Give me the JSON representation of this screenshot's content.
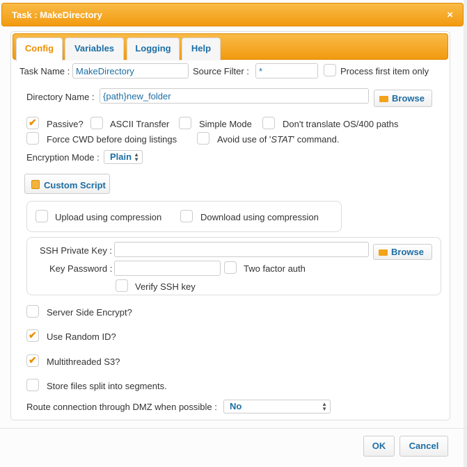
{
  "window": {
    "title": "Task : MakeDirectory",
    "close_glyph": "×"
  },
  "tabs": [
    {
      "label": "Config",
      "active": true
    },
    {
      "label": "Variables"
    },
    {
      "label": "Logging"
    },
    {
      "label": "Help"
    }
  ],
  "task_name": {
    "label": "Task Name :",
    "value": "MakeDirectory"
  },
  "source_filter": {
    "label": "Source Filter :",
    "value": "*"
  },
  "process_first": {
    "label": "Process first item only",
    "checked": false
  },
  "directory": {
    "label": "Directory Name :",
    "value": "{path}new_folder",
    "browse_label": "Browse"
  },
  "options": {
    "passive": {
      "label": "Passive?",
      "checked": true
    },
    "ascii": {
      "label": "ASCII Transfer",
      "checked": false
    },
    "simple": {
      "label": "Simple Mode",
      "checked": false
    },
    "os400": {
      "label": "Don't translate OS/400 paths",
      "checked": false
    },
    "force_cwd": {
      "label": "Force CWD before doing listings",
      "checked": false
    },
    "avoid_stat_prefix": "Avoid use of '",
    "avoid_stat_cmd": "STAT",
    "avoid_stat_suffix": "' command.",
    "avoid_stat_checked": false
  },
  "encryption": {
    "label": "Encryption Mode :",
    "value": "Plain"
  },
  "custom_script_label": "Custom Script",
  "compression": {
    "upload": {
      "label": "Upload using compression",
      "checked": false
    },
    "download": {
      "label": "Download using compression",
      "checked": false
    }
  },
  "ssh": {
    "private_key_label": "SSH Private Key :",
    "private_key_value": "",
    "browse_label": "Browse",
    "password_label": "Key Password :",
    "password_value": "",
    "two_factor": {
      "label": "Two factor auth",
      "checked": false
    },
    "verify": {
      "label": "Verify SSH key",
      "checked": false
    }
  },
  "s3": {
    "server_side_encrypt": {
      "label": "Server Side Encrypt?",
      "checked": false
    },
    "random_id": {
      "label": "Use Random ID?",
      "checked": true
    },
    "multithreaded": {
      "label": "Multithreaded S3?",
      "checked": true
    },
    "split_segments": {
      "label": "Store files split into segments.",
      "checked": false
    }
  },
  "dmz": {
    "label": "Route connection through DMZ when possible :",
    "value": "No"
  },
  "footer": {
    "ok_label": "OK",
    "cancel_label": "Cancel"
  },
  "colors": {
    "accent": "#f29a10",
    "link": "#1c6ea4",
    "active_tab": "#eb8f00"
  },
  "icons": {
    "checkmark": "✔",
    "folder": "folder-icon",
    "script": "script-icon"
  }
}
